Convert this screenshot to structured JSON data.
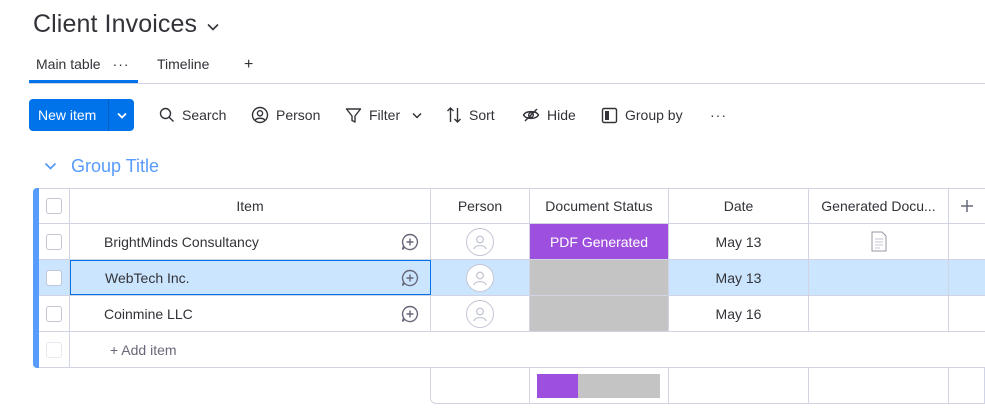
{
  "board": {
    "title": "Client Invoices"
  },
  "views": {
    "main": "Main table",
    "more": "···",
    "timeline": "Timeline",
    "add": "+"
  },
  "toolbar": {
    "new_item": "New item",
    "search": "Search",
    "person": "Person",
    "filter": "Filter",
    "sort": "Sort",
    "hide": "Hide",
    "group_by": "Group by",
    "more": "···"
  },
  "group": {
    "title": "Group Title",
    "color": "#579bfc"
  },
  "columns": {
    "item": "Item",
    "person": "Person",
    "status": "Document Status",
    "date": "Date",
    "generated": "Generated Docu...",
    "add": "+"
  },
  "rows": [
    {
      "name": "BrightMinds Consultancy",
      "status": "PDF Generated",
      "status_color": "#9d50dd",
      "date": "May 13",
      "has_doc": true
    },
    {
      "name": "WebTech Inc.",
      "status": "",
      "status_color": "#c4c4c4",
      "date": "May 13",
      "has_doc": false
    },
    {
      "name": "Coinmine LLC",
      "status": "",
      "status_color": "#c4c4c4",
      "date": "May 16",
      "has_doc": false
    }
  ],
  "add_item": "+ Add item",
  "summary": {
    "status_done_fraction": 0.333
  },
  "colors": {
    "accent": "#0073ea",
    "status_done": "#9d50dd",
    "status_empty": "#c4c4c4",
    "selected_row": "#cce5ff"
  }
}
